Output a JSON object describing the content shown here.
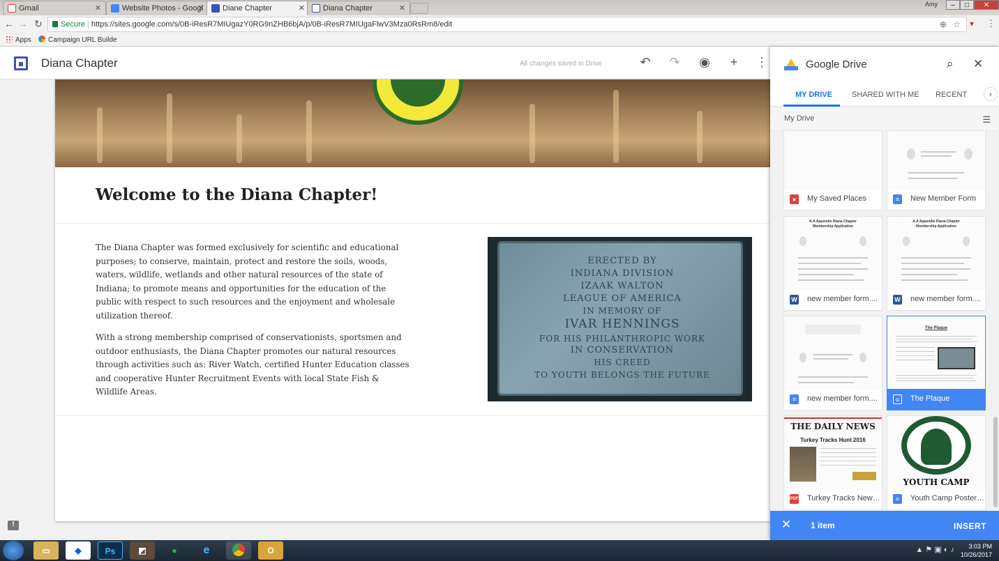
{
  "browser": {
    "tabs": [
      {
        "title": "Gmail",
        "active": false
      },
      {
        "title": "Website Photos - Googl",
        "active": false
      },
      {
        "title": "Diane Chapter",
        "active": true
      },
      {
        "title": "Diana Chapter",
        "active": false
      }
    ],
    "user": "Amy",
    "secure_label": "Secure",
    "url": "https://sites.google.com/s/0B-iResR7MIUgazY0RG9nZHB6bjA/p/0B-iResR7MIUgaFlwV3Mza0RsRm8/edit",
    "bookmarks": [
      "Apps",
      "Campaign URL Builde"
    ]
  },
  "editor": {
    "site_title": "Diana Chapter",
    "save_status": "All changes saved in Drive",
    "icons": [
      "undo-icon",
      "redo-icon",
      "preview-icon",
      "share-icon",
      "more-icon"
    ]
  },
  "page": {
    "heading": "Welcome to the Diana Chapter!",
    "paragraph1": "The Diana Chapter was formed exclusively for scientific and educational purposes; to conserve, maintain, protect and restore the soils, woods, waters, wildlife, wetlands and other natural resources of the state of Indiana; to promote means and opportunities for the education of the public with respect to such resources and the enjoyment and wholesale utilization thereof.",
    "paragraph2": "With a strong membership comprised of conservationists, sportsmen and outdoor enthusiasts, the Diana Chapter promotes our natural resources through activities such as: River Watch, certified Hunter Education classes and cooperative Hunter Recruitment Events with local State Fish & Wildlife Areas.",
    "plaque_lines": [
      "ERECTED BY",
      "INDIANA DIVISION",
      "IZAAK WALTON",
      "LEAGUE OF AMERICA",
      "IN MEMORY OF",
      "IVAR HENNINGS",
      "FOR HIS PHILANTHROPIC WORK",
      "IN CONSERVATION",
      "HIS CREED",
      "TO YOUTH BELONGS THE FUTURE"
    ]
  },
  "drive": {
    "title": "Google Drive",
    "tabs": [
      "MY DRIVE",
      "SHARED WITH ME",
      "RECENT"
    ],
    "breadcrumb": "My Drive",
    "files": [
      {
        "name": "My Saved Places",
        "type": "map",
        "icon_color": "#db4437",
        "selected": false
      },
      {
        "name": "New Member Form",
        "type": "doc",
        "icon_color": "#4285f4",
        "selected": false
      },
      {
        "name": "new member form....",
        "type": "word",
        "icon_color": "#2b579a",
        "selected": false
      },
      {
        "name": "new member form....",
        "type": "word",
        "icon_color": "#2b579a",
        "selected": false
      },
      {
        "name": "new member form....",
        "type": "doc",
        "icon_color": "#4285f4",
        "selected": false
      },
      {
        "name": "The Plaque",
        "type": "doc",
        "icon_color": "#ffffff",
        "selected": true
      },
      {
        "name": "Turkey Tracks News...",
        "type": "pdf",
        "icon_color": "#db4437",
        "selected": false
      },
      {
        "name": "Youth Camp Poster ...",
        "type": "doc",
        "icon_color": "#4285f4",
        "selected": false
      }
    ],
    "thumb_text": {
      "plaque_doc_title": "The Plaque",
      "news_title": "THE DAILY NEWS",
      "news_headline": "Turkey Tracks Hunt 2016",
      "poster_title": "YOUTH CAMP",
      "application_title": "A.A Appendix Diana Chapter",
      "application_subtitle": "Membership Application"
    },
    "selection_count": "1 item",
    "insert_label": "INSERT"
  },
  "taskbar": {
    "time": "3:03 PM",
    "date": "10/26/2017",
    "apps": [
      "file-explorer",
      "dropbox",
      "photoshop",
      "app",
      "spotify",
      "internet-explorer",
      "chrome",
      "outlook"
    ]
  }
}
